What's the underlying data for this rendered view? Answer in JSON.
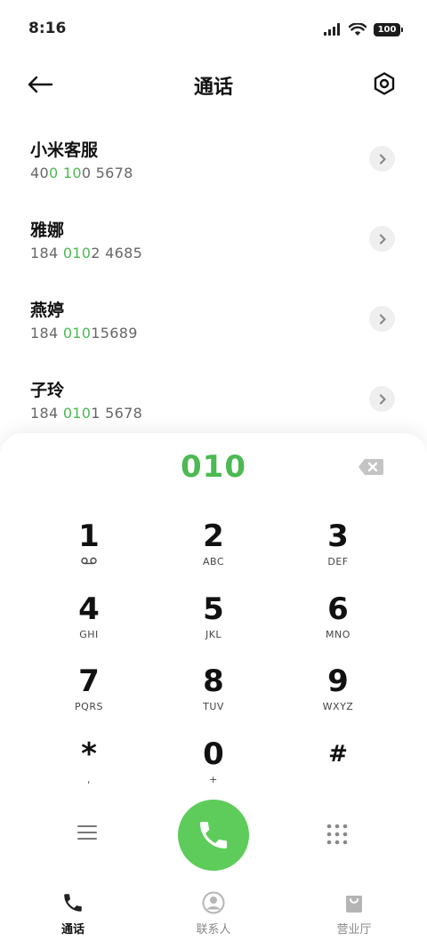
{
  "status": {
    "time": "8:16",
    "battery": "100"
  },
  "header": {
    "title": "通话"
  },
  "results": [
    {
      "name": "小米客服",
      "number_parts": [
        "40",
        "0",
        " ",
        "10",
        "0 5678"
      ]
    },
    {
      "name": "雅娜",
      "number_parts": [
        "184 ",
        "010",
        "2 4685"
      ]
    },
    {
      "name": "燕婷",
      "number_parts": [
        "184 ",
        "010",
        "15689"
      ]
    },
    {
      "name": "子玲",
      "number_parts": [
        "184 ",
        "010",
        "1 5678"
      ]
    }
  ],
  "dialpad": {
    "input": "010",
    "keys": [
      {
        "digit": "1",
        "letters": ""
      },
      {
        "digit": "2",
        "letters": "ABC"
      },
      {
        "digit": "3",
        "letters": "DEF"
      },
      {
        "digit": "4",
        "letters": "GHI"
      },
      {
        "digit": "5",
        "letters": "JKL"
      },
      {
        "digit": "6",
        "letters": "MNO"
      },
      {
        "digit": "7",
        "letters": "PQRS"
      },
      {
        "digit": "8",
        "letters": "TUV"
      },
      {
        "digit": "9",
        "letters": "WXYZ"
      },
      {
        "digit": "*",
        "letters": ","
      },
      {
        "digit": "0",
        "letters": "+"
      },
      {
        "digit": "#",
        "letters": ""
      }
    ]
  },
  "nav": {
    "calls": "通话",
    "contacts": "联系人",
    "service": "营业厅"
  },
  "colors": {
    "accent": "#4cb952",
    "call_button": "#5dcc5a"
  },
  "icons": {
    "key1": "voicemail-icon",
    "call": "phone-icon",
    "menu": "menu-icon",
    "keypad": "keypad-icon",
    "settings": "settings-icon",
    "back": "back-arrow-icon",
    "backspace": "backspace-icon"
  }
}
